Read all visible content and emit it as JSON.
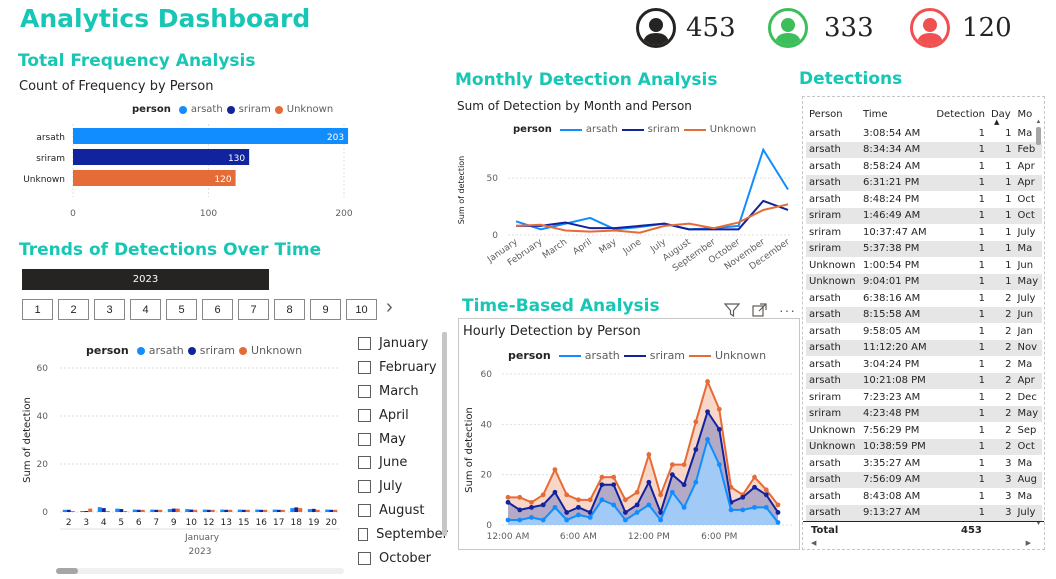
{
  "header": {
    "title": "Analytics Dashboard"
  },
  "kpis": [
    {
      "icon": "person-icon",
      "color": "#252423",
      "fill": "#252423",
      "value": "453"
    },
    {
      "icon": "person-icon",
      "color": "#3cbe5a",
      "fill": "#3cbe5a",
      "value": "333"
    },
    {
      "icon": "person-icon",
      "color": "#f0504f",
      "fill": "#f0504f",
      "value": "120"
    }
  ],
  "colors": {
    "arsath": "#118dff",
    "sriram": "#12239e",
    "unknown": "#e66c37",
    "teal": "#17c6b4"
  },
  "freq": {
    "section_title": "Total Frequency Analysis",
    "chart_title": "Count of Frequency by Person",
    "legend_title": "person",
    "legend": [
      "arsath",
      "sriram",
      "Unknown"
    ]
  },
  "trends": {
    "section_title": "Trends of Detections Over Time",
    "slicer_year": "2023",
    "pages": [
      "1",
      "2",
      "3",
      "4",
      "5",
      "6",
      "7",
      "8",
      "9",
      "10"
    ],
    "pager_next": "›",
    "legend_title": "person",
    "legend": [
      "arsath",
      "sriram",
      "Unknown"
    ],
    "month_label": "January",
    "year_label": "2023"
  },
  "months_slicer": [
    "January",
    "February",
    "March",
    "April",
    "May",
    "June",
    "July",
    "August",
    "September",
    "October"
  ],
  "monthly": {
    "section_title": "Monthly Detection Analysis",
    "chart_title": "Sum of Detection by Month and Person",
    "legend_title": "person",
    "legend": [
      "arsath",
      "sriram",
      "Unknown"
    ]
  },
  "time_based": {
    "section_title": "Time-Based Analysis",
    "chart_title": "Hourly Detection by Person",
    "legend_title": "person",
    "legend": [
      "arsath",
      "sriram",
      "Unknown"
    ]
  },
  "detections": {
    "section_title": "Detections",
    "columns": [
      "Person",
      "Time",
      "Detection",
      "Day",
      "Mo"
    ],
    "rows": [
      [
        "arsath",
        "3:08:54 AM",
        "1",
        "1",
        "Ma"
      ],
      [
        "arsath",
        "8:34:34 AM",
        "1",
        "1",
        "Feb"
      ],
      [
        "arsath",
        "8:58:24 AM",
        "1",
        "1",
        "Apr"
      ],
      [
        "arsath",
        "6:31:21 PM",
        "1",
        "1",
        "Apr"
      ],
      [
        "arsath",
        "8:48:24 PM",
        "1",
        "1",
        "Oct"
      ],
      [
        "sriram",
        "1:46:49 AM",
        "1",
        "1",
        "Oct"
      ],
      [
        "sriram",
        "10:37:47 AM",
        "1",
        "1",
        "July"
      ],
      [
        "sriram",
        "5:37:38 PM",
        "1",
        "1",
        "Ma"
      ],
      [
        "Unknown",
        "1:00:54 PM",
        "1",
        "1",
        "Jun"
      ],
      [
        "Unknown",
        "9:04:01 PM",
        "1",
        "1",
        "May"
      ],
      [
        "arsath",
        "6:38:16 AM",
        "1",
        "2",
        "July"
      ],
      [
        "arsath",
        "8:15:58 AM",
        "1",
        "2",
        "Jun"
      ],
      [
        "arsath",
        "9:58:05 AM",
        "1",
        "2",
        "Jan"
      ],
      [
        "arsath",
        "11:12:20 AM",
        "1",
        "2",
        "Nov"
      ],
      [
        "arsath",
        "3:04:24 PM",
        "1",
        "2",
        "Ma"
      ],
      [
        "arsath",
        "10:21:08 PM",
        "1",
        "2",
        "Apr"
      ],
      [
        "sriram",
        "7:23:23 AM",
        "1",
        "2",
        "Dec"
      ],
      [
        "sriram",
        "4:23:48 PM",
        "1",
        "2",
        "May"
      ],
      [
        "Unknown",
        "7:56:29 PM",
        "1",
        "2",
        "Sep"
      ],
      [
        "Unknown",
        "10:38:59 PM",
        "1",
        "2",
        "Oct"
      ],
      [
        "arsath",
        "3:35:27 AM",
        "1",
        "3",
        "Ma"
      ],
      [
        "arsath",
        "7:56:09 AM",
        "1",
        "3",
        "Aug"
      ],
      [
        "arsath",
        "8:43:08 AM",
        "1",
        "3",
        "Ma"
      ],
      [
        "arsath",
        "9:13:27 AM",
        "1",
        "3",
        "July"
      ]
    ],
    "total_label": "Total",
    "total_value": "453"
  },
  "chart_data": [
    {
      "type": "bar",
      "orientation": "horizontal",
      "title": "Count of Frequency by Person",
      "categories": [
        "arsath",
        "sriram",
        "Unknown"
      ],
      "values": [
        203,
        130,
        120
      ],
      "data_labels": [
        "203",
        "130",
        "120"
      ],
      "colors": [
        "#118dff",
        "#12239e",
        "#e66c37"
      ],
      "xlim": [
        0,
        200
      ],
      "xticks": [
        "0",
        "100",
        "200"
      ],
      "grid": true,
      "legend": "top-center"
    },
    {
      "type": "bar",
      "title": "",
      "xlabel": "2023",
      "ylabel": "Sum of detection",
      "categories": [
        "2",
        "3",
        "4",
        "5",
        "6",
        "7",
        "9",
        "10",
        "12",
        "13",
        "15",
        "16",
        "17",
        "18",
        "19",
        "20"
      ],
      "series": [
        {
          "name": "arsath",
          "values": [
            0.5,
            0,
            1.6,
            1,
            0.6,
            0.6,
            0.8,
            0.8,
            0.6,
            0.6,
            0.6,
            0.6,
            0.6,
            1.2,
            0.8,
            0.6
          ]
        },
        {
          "name": "sriram",
          "values": [
            0.5,
            0,
            1.2,
            0.8,
            0.5,
            0.5,
            1,
            0.6,
            0.5,
            0.5,
            0.5,
            0.5,
            0.5,
            1.5,
            0.9,
            0.5
          ]
        },
        {
          "name": "Unknown",
          "values": [
            0,
            1,
            0,
            0,
            0.5,
            0.5,
            1,
            0.5,
            0.5,
            0.5,
            0.5,
            0.5,
            0.5,
            1.2,
            0.5,
            0.5
          ]
        }
      ],
      "ylim": [
        0,
        60
      ],
      "yticks": [
        "0",
        "20",
        "40",
        "60"
      ],
      "grid": true,
      "legend": "top-center"
    },
    {
      "type": "line",
      "title": "Sum of Detection by Month and Person",
      "ylabel": "Sum of detection",
      "categories": [
        "January",
        "February",
        "March",
        "April",
        "May",
        "June",
        "July",
        "August",
        "September",
        "October",
        "November",
        "December"
      ],
      "series": [
        {
          "name": "arsath",
          "values": [
            12,
            5,
            10,
            15,
            5,
            7,
            10,
            5,
            6,
            8,
            75,
            40
          ]
        },
        {
          "name": "sriram",
          "values": [
            8,
            8,
            11,
            6,
            6,
            8,
            10,
            5,
            5,
            5,
            30,
            22
          ]
        },
        {
          "name": "Unknown",
          "values": [
            8,
            9,
            4,
            3,
            4,
            2,
            8,
            10,
            6,
            11,
            22,
            27
          ]
        }
      ],
      "ylim": [
        0,
        80
      ],
      "yticks": [
        "0",
        "50"
      ],
      "grid": true,
      "legend": "top-center"
    },
    {
      "type": "area",
      "title": "Hourly Detection by Person",
      "ylabel": "Sum of detection",
      "x": [
        0,
        1,
        2,
        3,
        4,
        5,
        6,
        7,
        8,
        9,
        10,
        11,
        12,
        13,
        14,
        15,
        16,
        17,
        18,
        19,
        20,
        21,
        22,
        23
      ],
      "xticks": [
        "12:00 AM",
        "6:00 AM",
        "12:00 PM",
        "6:00 PM"
      ],
      "series": [
        {
          "name": "arsath",
          "values": [
            2,
            2,
            3,
            2,
            7,
            2,
            4,
            3,
            10,
            8,
            2,
            5,
            8,
            2,
            13,
            7,
            17,
            34,
            24,
            6,
            6,
            7,
            7,
            1
          ]
        },
        {
          "name": "sriram",
          "values": [
            9,
            6,
            7,
            8,
            13,
            5,
            7,
            5,
            16,
            16,
            5,
            8,
            17,
            5,
            20,
            16,
            30,
            45,
            38,
            9,
            11,
            15,
            12,
            5
          ]
        },
        {
          "name": "Unknown",
          "values": [
            11,
            11,
            9,
            12,
            22,
            12,
            10,
            10,
            19,
            19,
            10,
            13,
            28,
            12,
            24,
            24,
            41,
            57,
            46,
            15,
            12,
            19,
            14,
            8
          ]
        }
      ],
      "ylim": [
        0,
        60
      ],
      "yticks": [
        "0",
        "20",
        "40",
        "60"
      ],
      "grid": true,
      "legend": "top-center"
    }
  ]
}
